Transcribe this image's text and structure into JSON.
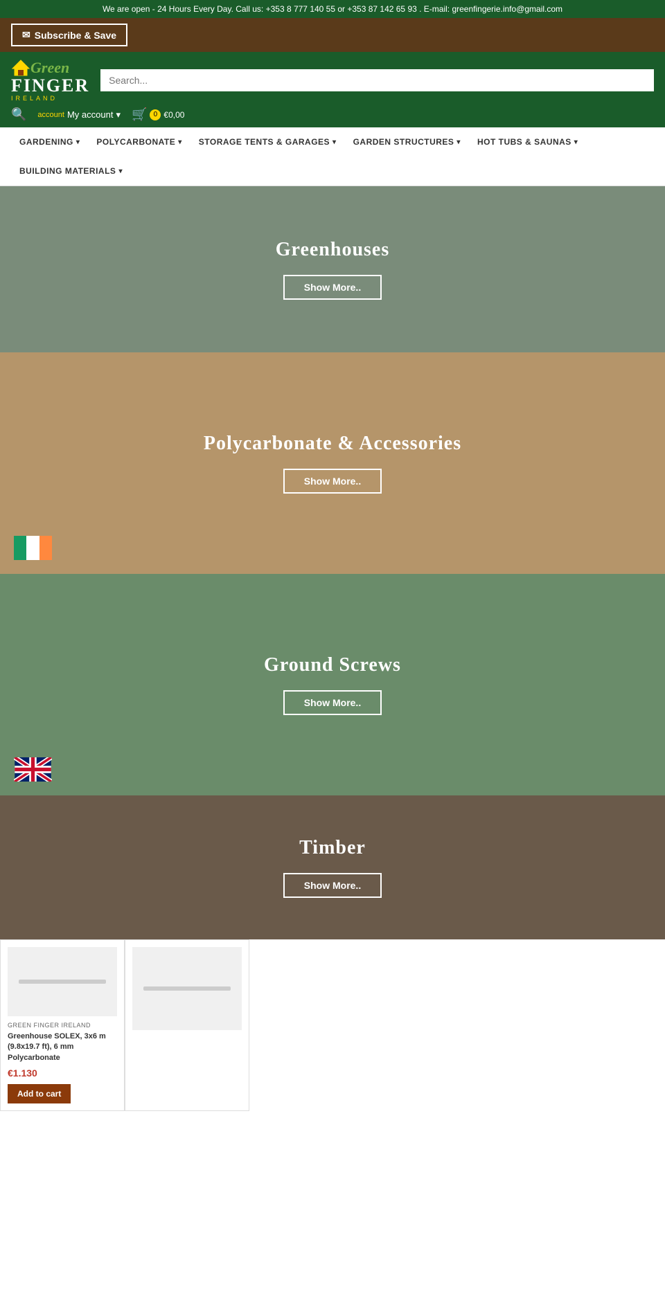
{
  "topbar": {
    "text": "We are open - 24 Hours Every Day. Call us: +353 8 777 140 55 or +353 87 142 65 93 . E-mail: greenfingerie.info@gmail.com"
  },
  "subscribe": {
    "label": "Subscribe & Save"
  },
  "logo": {
    "green": "Green",
    "finger": "FINGER",
    "ireland": "IRELAND"
  },
  "search": {
    "placeholder": "Search..."
  },
  "account": {
    "label": "account",
    "my_account": "My account",
    "cart_count": "0",
    "cart_total": "€0,00"
  },
  "nav": {
    "items": [
      {
        "label": "GARDENING",
        "has_dropdown": true
      },
      {
        "label": "POLYCARBONATE",
        "has_dropdown": true
      },
      {
        "label": "STORAGE TENTS & GARAGES",
        "has_dropdown": true
      },
      {
        "label": "GARDEN STRUCTURES",
        "has_dropdown": true
      },
      {
        "label": "HOT TUBS & SAUNAS",
        "has_dropdown": true
      },
      {
        "label": "BUILDING MATERIALS",
        "has_dropdown": true
      }
    ]
  },
  "sections": [
    {
      "id": "greenhouses",
      "title": "Greenhouses",
      "btn_label": "Show More..",
      "bg_class": "banner-greenhouses"
    },
    {
      "id": "polycarbonate",
      "title": "Polycarbonate & Accessories",
      "btn_label": "Show More..",
      "bg_class": "banner-polycarbonate",
      "flag": "ie"
    },
    {
      "id": "ground-screws",
      "title": "Ground Screws",
      "btn_label": "Show More..",
      "bg_class": "banner-ground-screws",
      "flag": "uk"
    },
    {
      "id": "timber",
      "title": "Timber",
      "btn_label": "Show More..",
      "bg_class": "banner-timber"
    }
  ],
  "products": [
    {
      "brand": "GREEN FINGER IRELAND",
      "name": "Greenhouse SOLEX, 3x6 m (9.8x19.7 ft), 6 mm Polycarbonate",
      "price": "€1.130",
      "btn_label": "Add to cart"
    }
  ]
}
